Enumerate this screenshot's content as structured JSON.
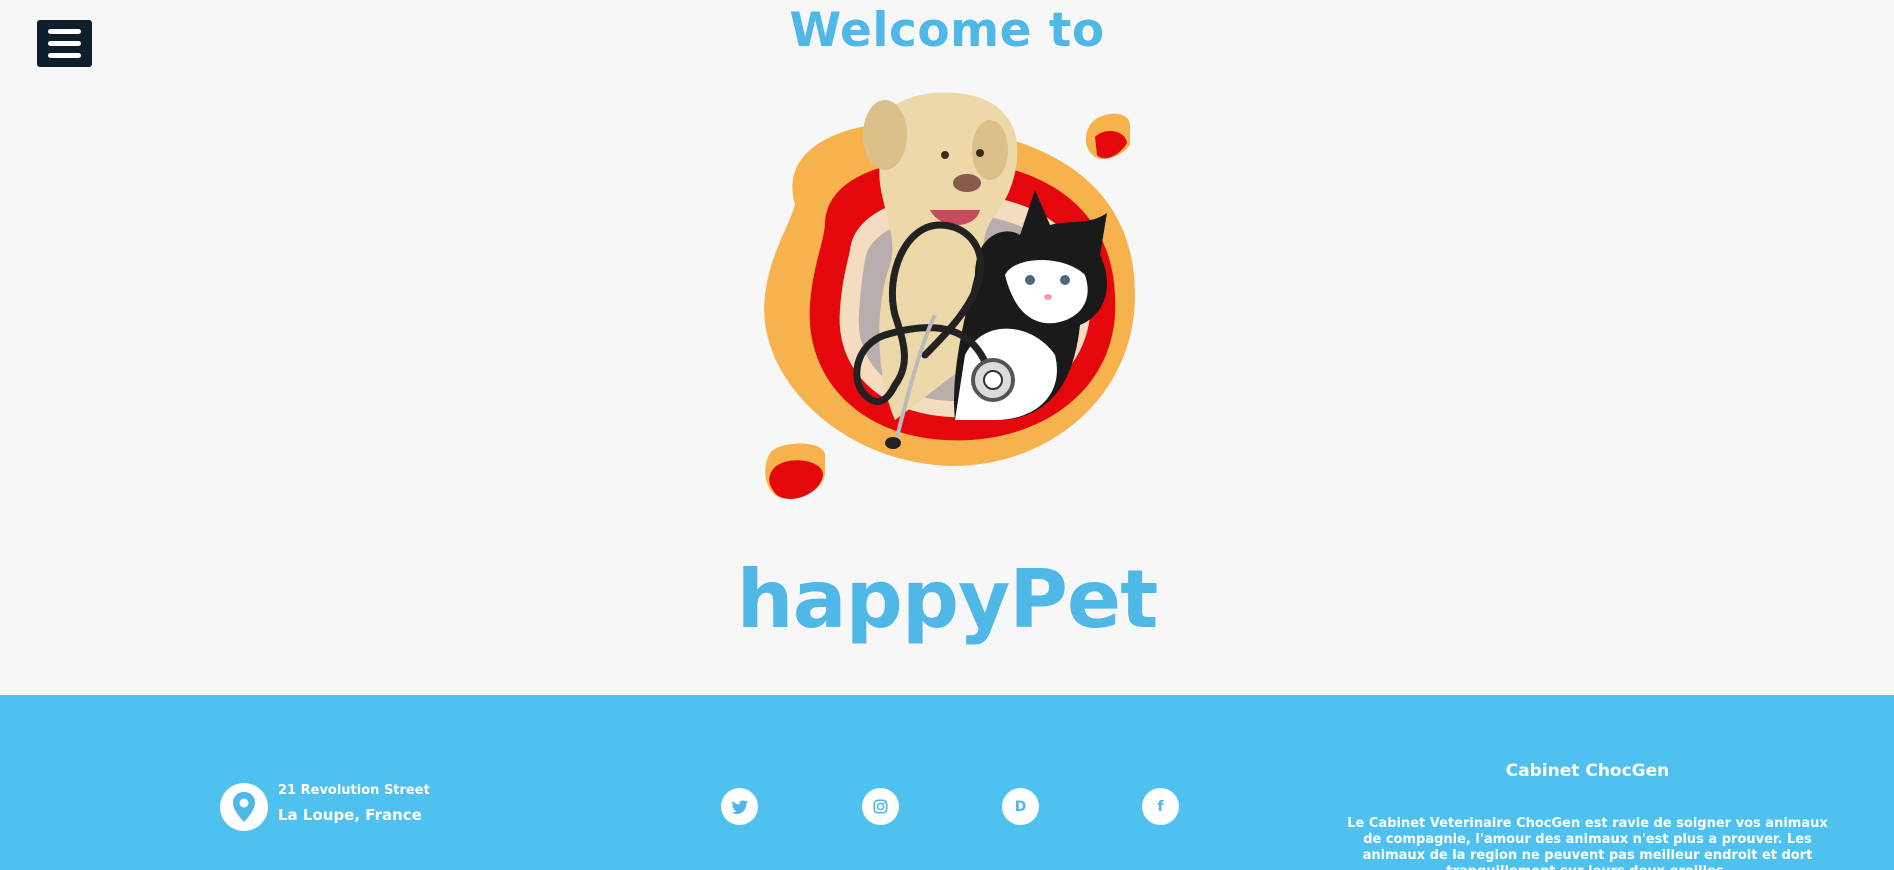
{
  "header": {
    "menu_icon": "hamburger-menu-icon",
    "welcome": "Welcome to"
  },
  "hero": {
    "image": "dog-cat-stethoscope-logo"
  },
  "brand": {
    "name": "happyPet"
  },
  "colors": {
    "accent": "#4fb8e7",
    "footer_bg": "#4fc1ee",
    "menu_bg": "#0e1e2b",
    "blob_orange": "#f5b24d",
    "blob_red": "#e4080c"
  },
  "footer": {
    "address_icon": "map-pin-icon",
    "street": "21 Revolution Street",
    "city": "La Loupe, France",
    "social": [
      {
        "icon": "twitter-icon"
      },
      {
        "icon": "instagram-icon"
      },
      {
        "icon": "dribbble-icon",
        "glyph": "D"
      },
      {
        "icon": "facebook-icon",
        "glyph": "f"
      }
    ],
    "cabinet": {
      "title": "Cabinet ChocGen",
      "text": "Le Cabinet Veterinaire ChocGen est ravie de soigner vos animaux de compagnie, l'amour des animaux n'est plus a prouver. Les animaux de la region ne peuvent pas meilleur endroit et dort tranquillement sur leurs deux oreilles."
    }
  }
}
